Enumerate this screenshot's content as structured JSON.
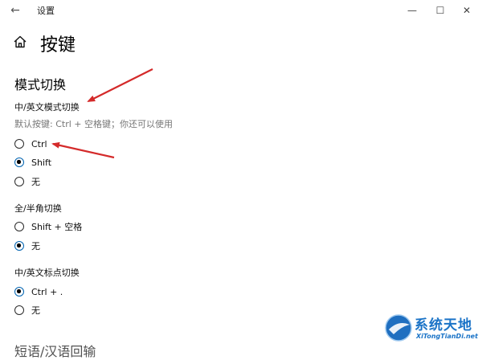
{
  "titlebar": {
    "back_glyph": "←",
    "title": "设置",
    "minimize_glyph": "—",
    "maximize_glyph": "☐",
    "close_glyph": "✕"
  },
  "page": {
    "title": "按键",
    "home_icon": "home-icon"
  },
  "section": {
    "heading": "模式切换"
  },
  "groups": [
    {
      "label": "中/英文模式切换",
      "description": "默认按键: Ctrl + 空格键；你还可以使用",
      "options": [
        {
          "label": "Ctrl",
          "checked": false
        },
        {
          "label": "Shift",
          "checked": true
        },
        {
          "label": "无",
          "checked": false
        }
      ]
    },
    {
      "label": "全/半角切换",
      "options": [
        {
          "label": "Shift + 空格",
          "checked": false
        },
        {
          "label": "无",
          "checked": true
        }
      ]
    },
    {
      "label": "中/英文标点切换",
      "options": [
        {
          "label": "Ctrl + .",
          "checked": true
        },
        {
          "label": "无",
          "checked": false
        }
      ]
    }
  ],
  "partial_heading": "短语/汉语回输",
  "annotation": {
    "arrow_color": "#d42a2a"
  },
  "accent_color": "#0063b1",
  "watermark": {
    "cn": "系统天地",
    "en": "XiTongTianDi.net",
    "color": "#1a73c7"
  }
}
